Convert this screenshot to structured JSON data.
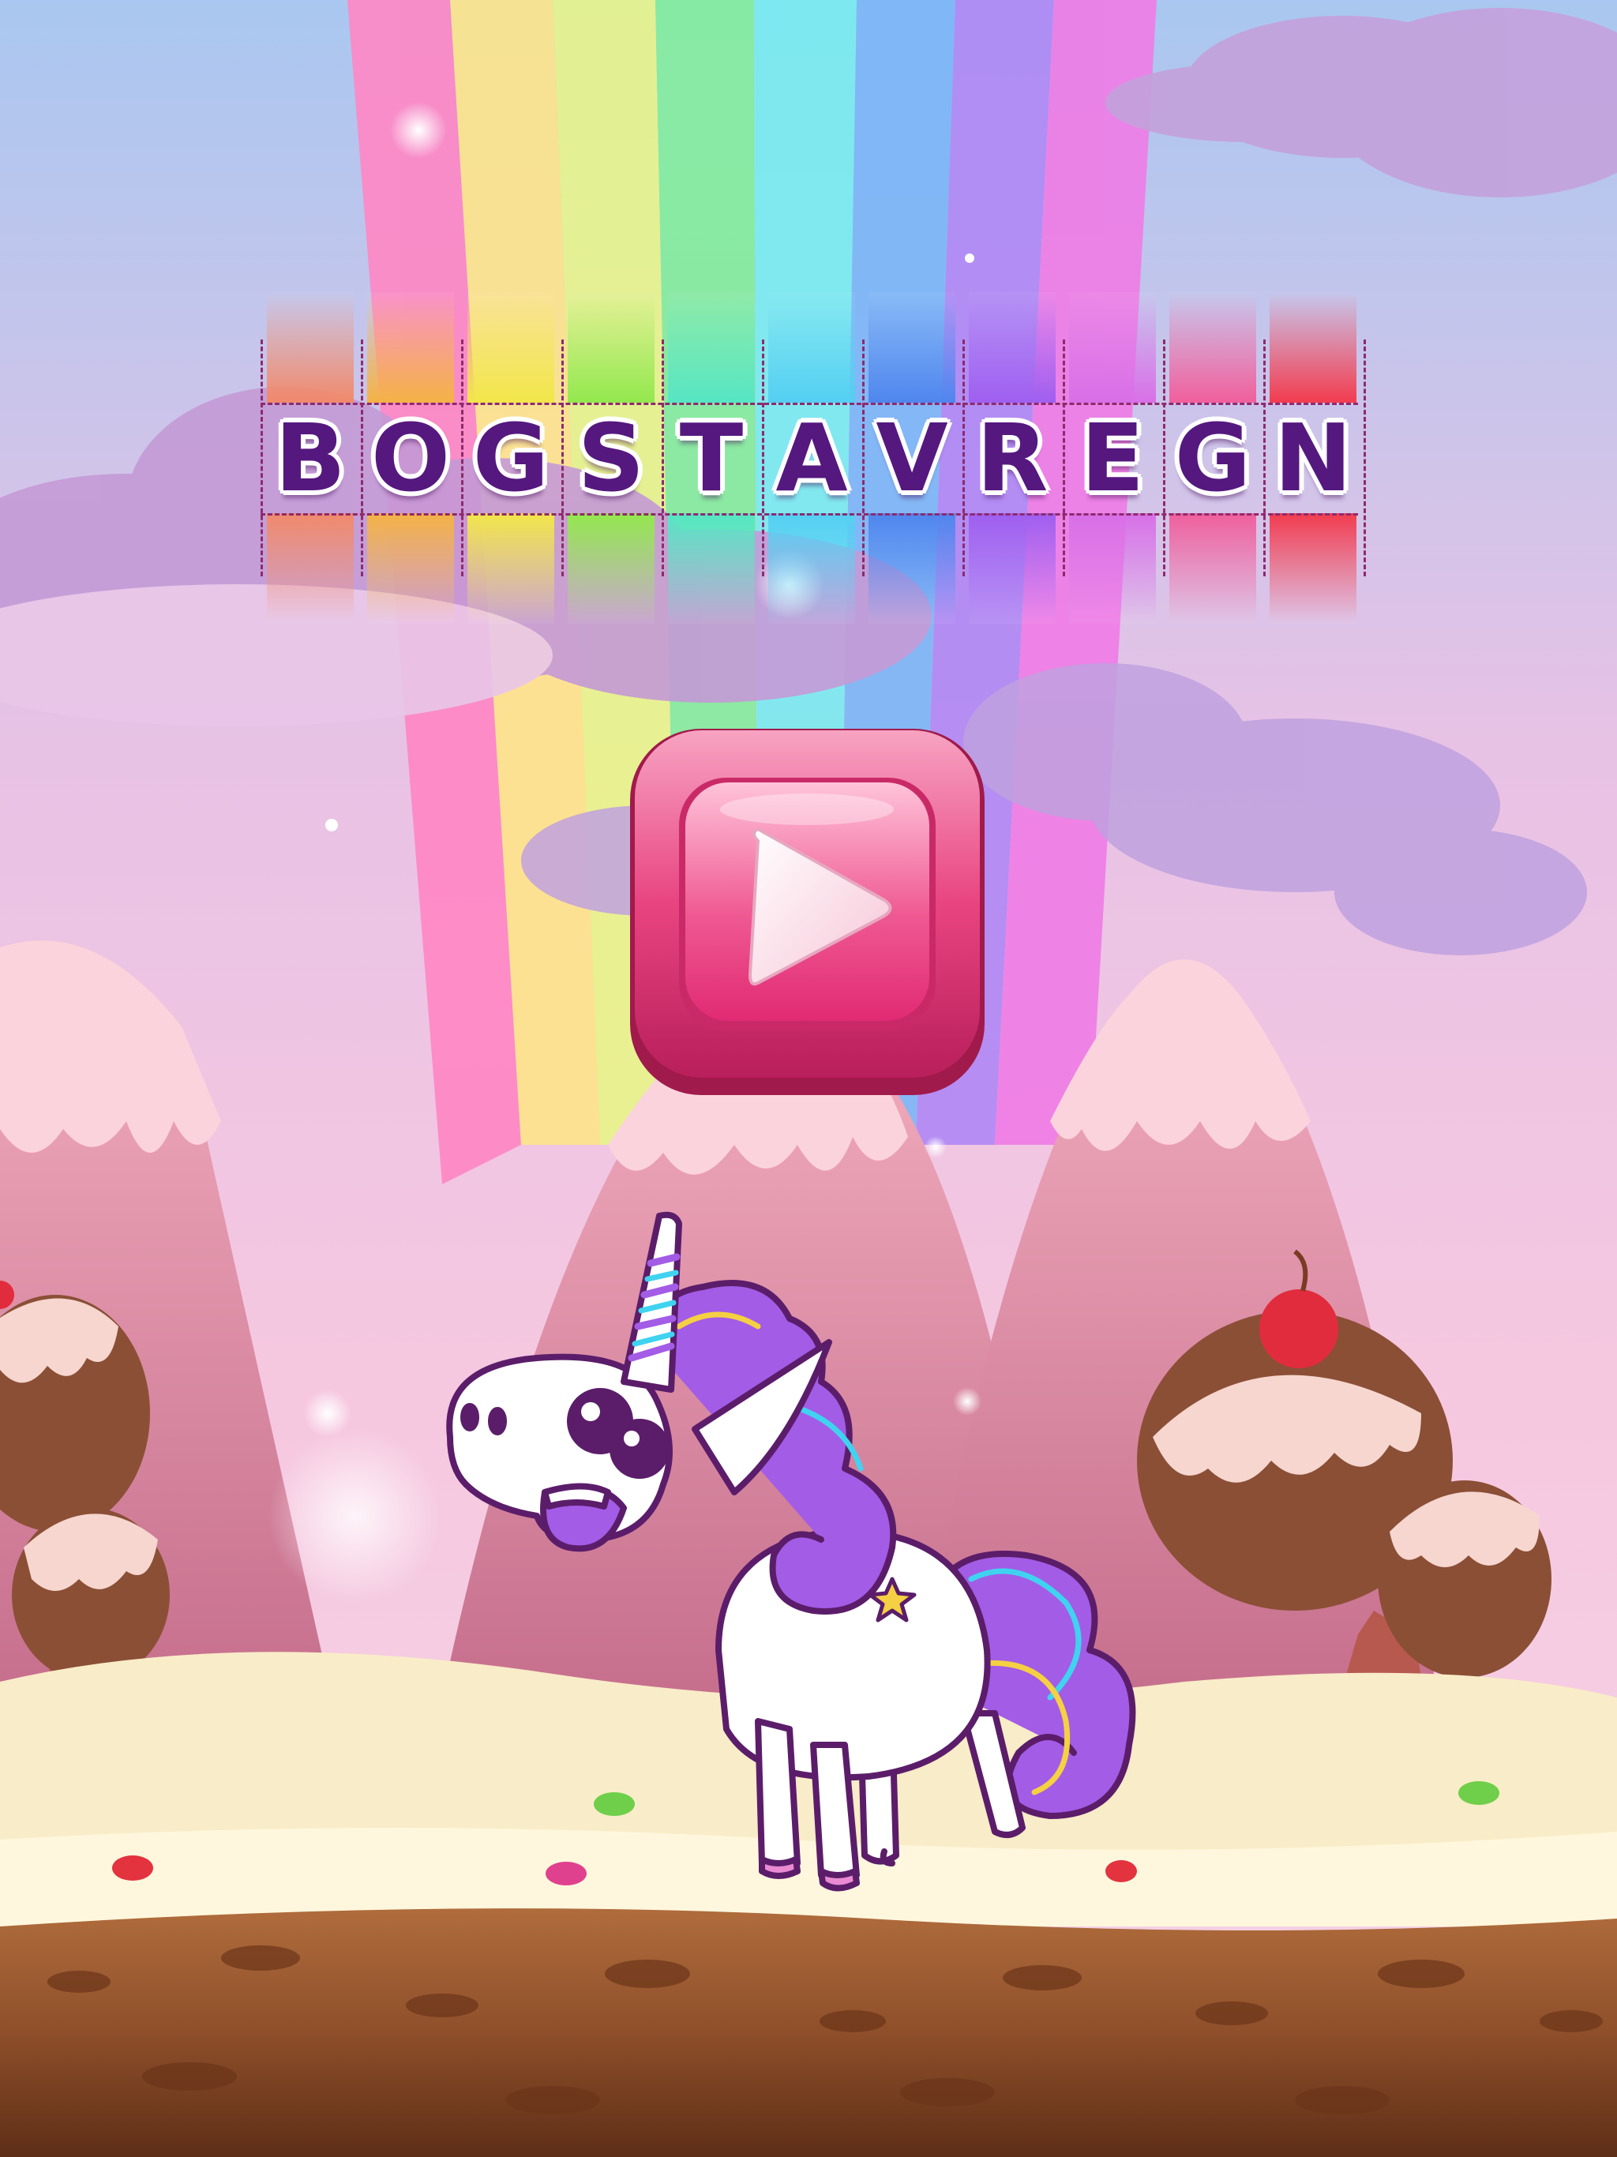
{
  "game": {
    "title_letters": [
      "B",
      "O",
      "G",
      "S",
      "T",
      "A",
      "V",
      "R",
      "E",
      "G",
      "N"
    ],
    "tile_colors": [
      "#f08a6b",
      "#f4b246",
      "#f2e64a",
      "#93e84e",
      "#56e6c3",
      "#54cff2",
      "#4f86ee",
      "#9f5ff0",
      "#d86fe7",
      "#f05f9c",
      "#f23c4f"
    ],
    "play_button_icon": "play-triangle-icon"
  },
  "colors": {
    "title_text": "#55187f",
    "button_pink": "#ee3f82",
    "sky": "#cfd0f3",
    "ground": "#9a5a33"
  }
}
